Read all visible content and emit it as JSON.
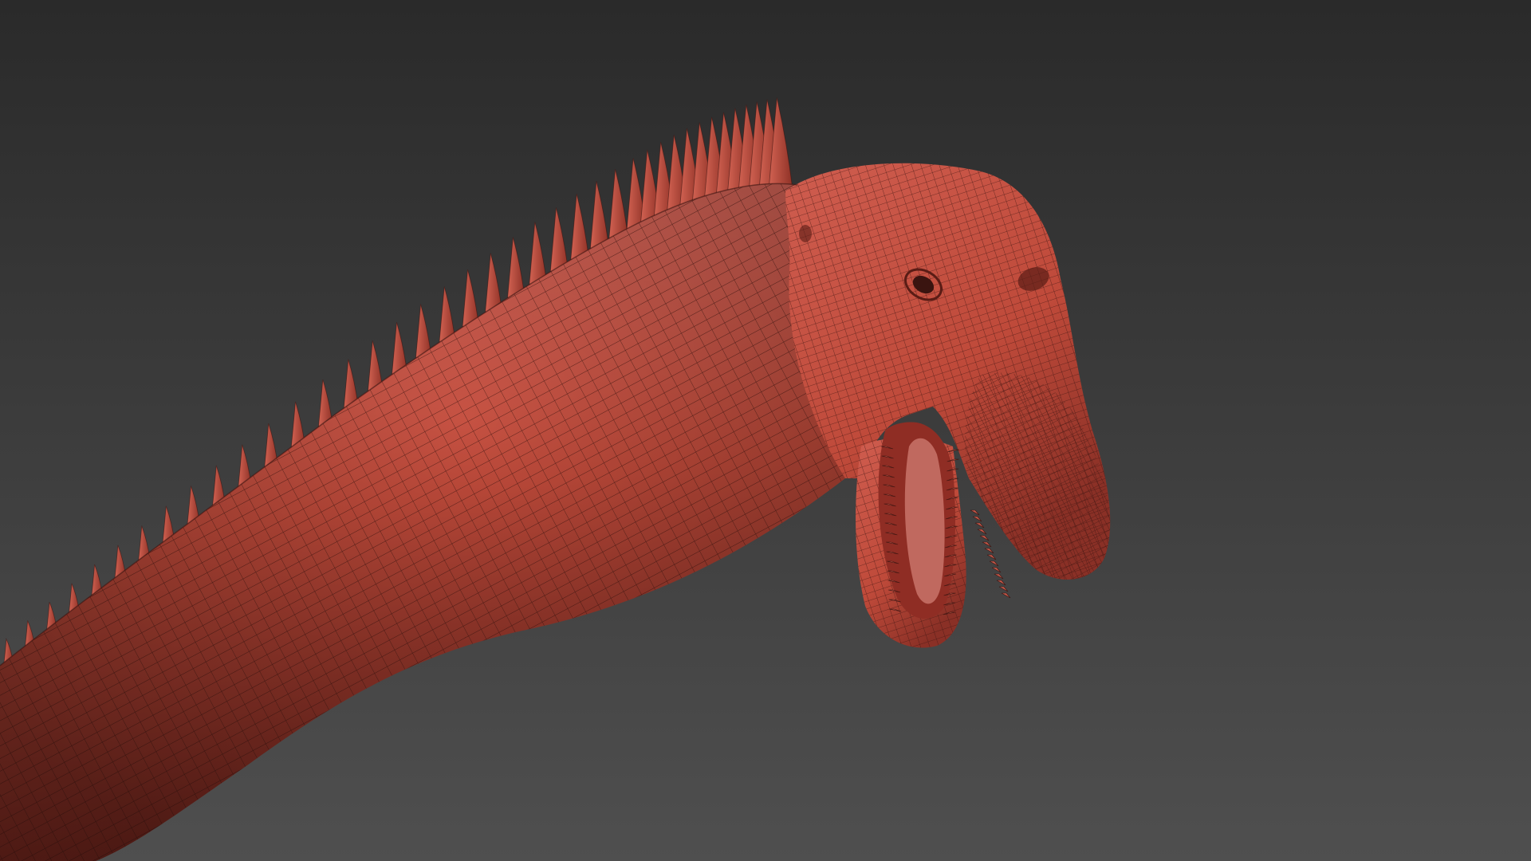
{
  "scene": {
    "background": {
      "top_color": "#2a2a2a",
      "bottom_color": "#4f4f4f"
    },
    "model": {
      "skin_color": "#bf4a3a",
      "skin_shadow_color": "#6e231b",
      "skin_highlight_color": "#d9675a",
      "wire_color": "#3b1410",
      "mouth_color": "#8f2d24",
      "tongue_color": "#c9746a",
      "tooth_color": "#c65a4b"
    }
  }
}
